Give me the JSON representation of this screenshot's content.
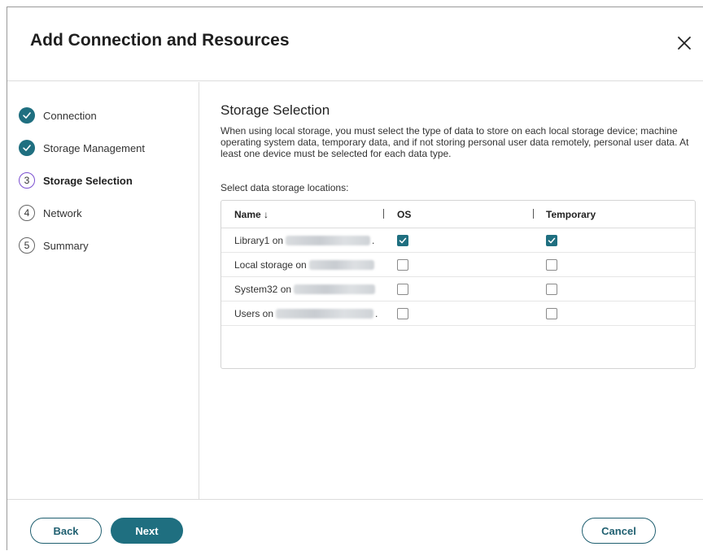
{
  "dialog": {
    "title": "Add Connection and Resources"
  },
  "steps": [
    {
      "number": "1",
      "label": "Connection",
      "state": "done"
    },
    {
      "number": "2",
      "label": "Storage Management",
      "state": "done"
    },
    {
      "number": "3",
      "label": "Storage Selection",
      "state": "current"
    },
    {
      "number": "4",
      "label": "Network",
      "state": "pending"
    },
    {
      "number": "5",
      "label": "Summary",
      "state": "pending"
    }
  ],
  "content": {
    "section_title": "Storage Selection",
    "description": "When using local storage, you must select the type of data to store on each local storage device; machine operating system data, temporary data, and if not storing personal user data remotely, personal user data. At least one device must be selected for each data type.",
    "select_label": "Select data storage locations:"
  },
  "table": {
    "columns": [
      "Name ↓",
      "OS",
      "Temporary"
    ],
    "rows": [
      {
        "name": "Library1 on",
        "os": true,
        "temporary": true
      },
      {
        "name": "Local storage on",
        "os": false,
        "temporary": false
      },
      {
        "name": "System32 on",
        "os": false,
        "temporary": false
      },
      {
        "name": "Users on",
        "os": false,
        "temporary": false
      }
    ]
  },
  "footer": {
    "back_label": "Back",
    "next_label": "Next",
    "cancel_label": "Cancel"
  },
  "colors": {
    "accent": "#1f6f80",
    "current_step_ring": "#7b4fd0"
  }
}
